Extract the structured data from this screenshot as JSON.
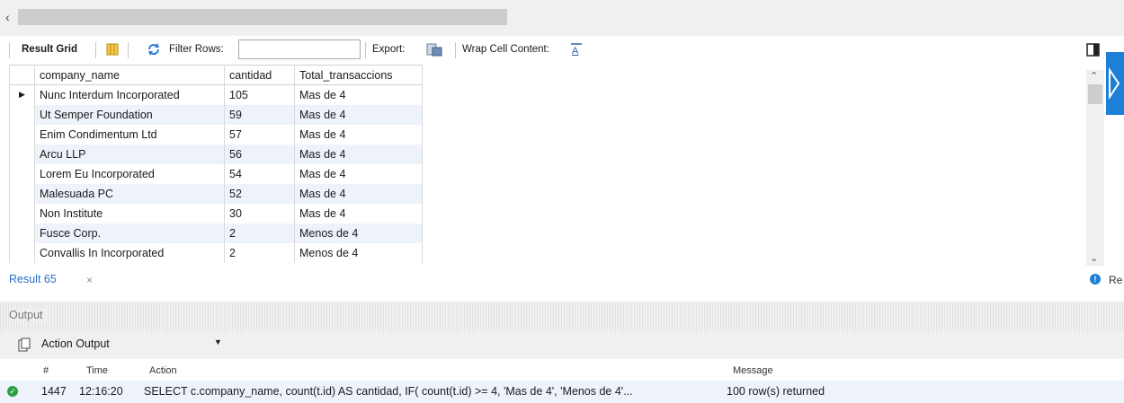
{
  "toolbar": {
    "result_grid_label": "Result Grid",
    "filter_rows_label": "Filter Rows:",
    "filter_value": "",
    "export_label": "Export:",
    "wrap_label": "Wrap Cell Content:"
  },
  "grid": {
    "columns": [
      "company_name",
      "cantidad",
      "Total_transaccions"
    ],
    "rows": [
      [
        "Nunc Interdum Incorporated",
        "105",
        "Mas de 4"
      ],
      [
        "Ut Semper Foundation",
        "59",
        "Mas de 4"
      ],
      [
        "Enim Condimentum Ltd",
        "57",
        "Mas de 4"
      ],
      [
        "Arcu LLP",
        "56",
        "Mas de 4"
      ],
      [
        "Lorem Eu Incorporated",
        "54",
        "Mas de 4"
      ],
      [
        "Malesuada PC",
        "52",
        "Mas de 4"
      ],
      [
        "Non Institute",
        "30",
        "Mas de 4"
      ],
      [
        "Fusce Corp.",
        "2",
        "Menos de 4"
      ],
      [
        "Convallis In Incorporated",
        "2",
        "Menos de 4"
      ]
    ],
    "current_row_marker": "▶"
  },
  "result_tab": {
    "label": "Result 65",
    "close": "×",
    "info_text": "Re"
  },
  "output": {
    "title": "Output",
    "selector_value": "Action Output",
    "headers": {
      "num": "#",
      "time": "Time",
      "action": "Action",
      "message": "Message"
    },
    "row": {
      "num": "1447",
      "time": "12:16:20",
      "action": "SELECT c.company_name, count(t.id) AS cantidad, IF( count(t.id) >= 4, 'Mas de 4', 'Menos de 4'...",
      "message": "100 row(s) returned",
      "status_icon": "success-check-icon"
    }
  },
  "colors": {
    "accent": "#1e7fd6",
    "alt_row": "#eef3fb",
    "success": "#2ea043",
    "tab_text": "#2a6fc9"
  }
}
